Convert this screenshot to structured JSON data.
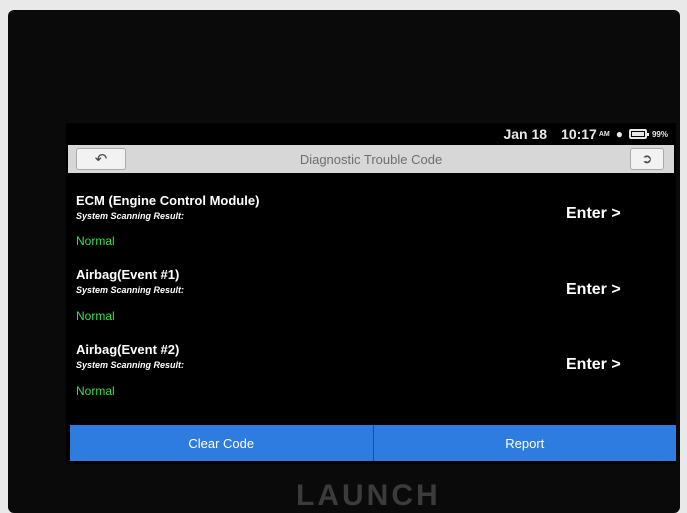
{
  "status_bar": {
    "date": "Jan 18",
    "time": "10:17",
    "ampm": "AM",
    "battery": "99%",
    "wifi_icon": "wifi-icon",
    "battery_icon": "battery-icon"
  },
  "header": {
    "title": "Diagnostic Trouble Code",
    "back_icon": "back-arrow-icon",
    "exit_icon": "exit-icon"
  },
  "modules": [
    {
      "name": "ECM (Engine Control Module)",
      "subtitle": "System Scanning Result:",
      "result": "Normal",
      "enter": "Enter >"
    },
    {
      "name": "Airbag(Event #1)",
      "subtitle": "System Scanning Result:",
      "result": "Normal",
      "enter": "Enter >"
    },
    {
      "name": "Airbag(Event #2)",
      "subtitle": "System Scanning Result:",
      "result": "Normal",
      "enter": "Enter >"
    }
  ],
  "actions": {
    "clear_code": "Clear Code",
    "report": "Report"
  },
  "brand": "LAUNCH",
  "colors": {
    "accent": "#2e7cdf",
    "normal_status": "#35e04a",
    "title_bar": "#d7d7d7"
  }
}
